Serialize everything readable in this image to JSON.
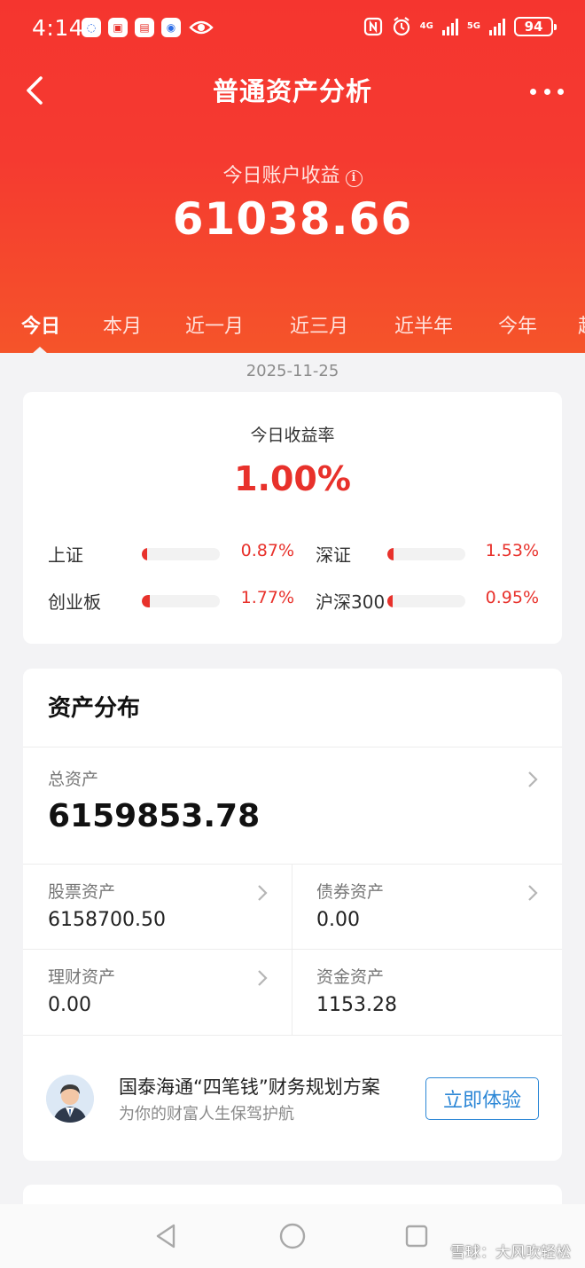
{
  "status_bar": {
    "time": "4:14",
    "net1": "4G",
    "net2": "5G",
    "battery": "94"
  },
  "nav": {
    "title": "普通资产分析"
  },
  "summary": {
    "income_label": "今日账户收益",
    "income_value": "61038.66"
  },
  "tabs": [
    "今日",
    "本月",
    "近一月",
    "近三月",
    "近半年",
    "今年",
    "起"
  ],
  "date": "2025-11-25",
  "rate_card": {
    "label": "今日收益率",
    "value": "1.00%",
    "indices": [
      {
        "name": "上证",
        "value": "0.87%",
        "level": 0.087
      },
      {
        "name": "深证",
        "value": "1.53%",
        "level": 0.153
      },
      {
        "name": "创业板",
        "value": "1.77%",
        "level": 0.177
      },
      {
        "name": "沪深300",
        "value": "0.95%",
        "level": 0.095
      }
    ]
  },
  "asset_card": {
    "title": "资产分布",
    "total_label": "总资产",
    "total_value": "6159853.78",
    "items": [
      {
        "label": "股票资产",
        "value": "6158700.50"
      },
      {
        "label": "债券资产",
        "value": "0.00"
      },
      {
        "label": "理财资产",
        "value": "0.00"
      },
      {
        "label": "资金资产",
        "value": "1153.28"
      }
    ],
    "promo": {
      "title": "国泰海通“四笔钱”财务规划方案",
      "subtitle": "为你的财富人生保驾护航",
      "button": "立即体验"
    }
  },
  "watermark": "雪球：大风吹轻松",
  "colors": {
    "brand_red": "#e8312b",
    "link_blue": "#2c87d6"
  }
}
